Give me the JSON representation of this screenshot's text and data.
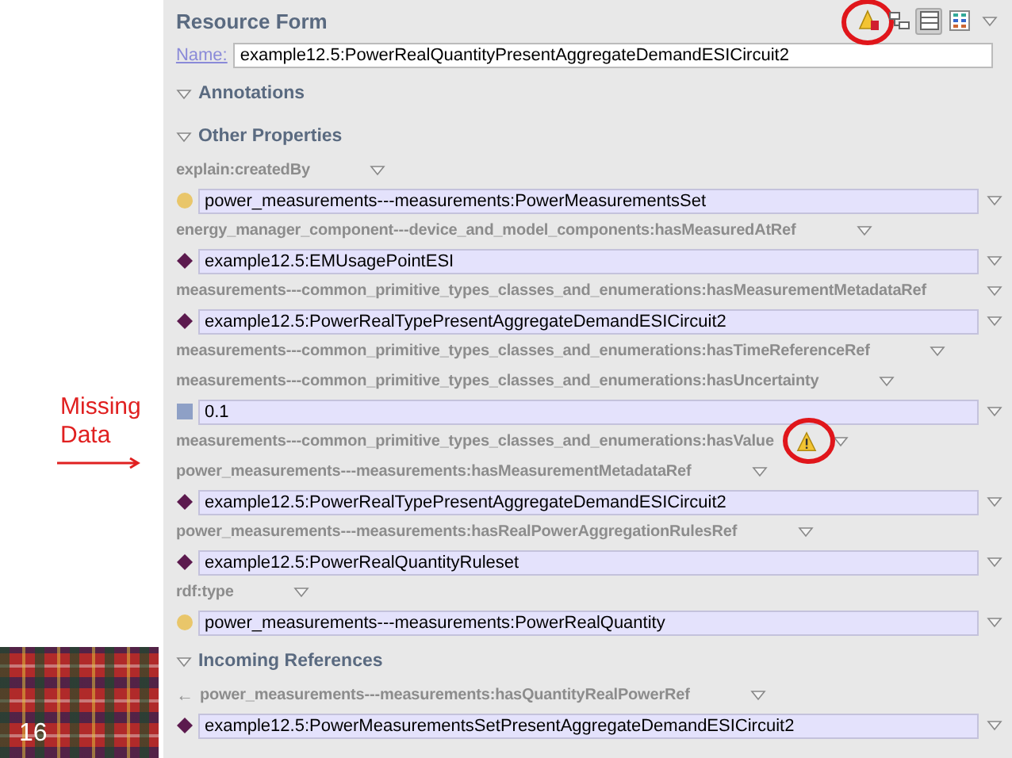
{
  "slide": {
    "callout": "Missing Data",
    "page_number": "16"
  },
  "form": {
    "title": "Resource Form",
    "toolbar": [
      {
        "kind": "warning",
        "pressed": false,
        "circled": true
      },
      {
        "kind": "hierarchy",
        "pressed": false,
        "circled": false
      },
      {
        "kind": "layout",
        "pressed": true,
        "circled": false
      },
      {
        "kind": "grid",
        "pressed": false,
        "circled": false
      },
      {
        "kind": "menu",
        "pressed": false,
        "circled": false
      }
    ],
    "name_label": "Name:",
    "name_value": "example12.5:PowerRealQuantityPresentAggregateDemandESICircuit2",
    "sections": [
      {
        "title": "Annotations"
      },
      {
        "title": "Other Properties",
        "properties": [
          {
            "label": "explain:createdBy",
            "warning": false,
            "value": {
              "kind": "circle",
              "text": "power_measurements---measurements:PowerMeasurementsSet"
            }
          },
          {
            "label": "energy_manager_component---device_and_model_components:hasMeasuredAtRef",
            "warning": false,
            "value": {
              "kind": "diamond",
              "text": "example12.5:EMUsagePointESI"
            }
          },
          {
            "label": "measurements---common_primitive_types_classes_and_enumerations:hasMeasurementMetadataRef",
            "warning": false,
            "value": {
              "kind": "diamond",
              "text": "example12.5:PowerRealTypePresentAggregateDemandESICircuit2"
            }
          },
          {
            "label": "measurements---common_primitive_types_classes_and_enumerations:hasTimeReferenceRef",
            "warning": false
          },
          {
            "label": "measurements---common_primitive_types_classes_and_enumerations:hasUncertainty",
            "warning": false,
            "value": {
              "kind": "square",
              "text": "0.1"
            }
          },
          {
            "label": "measurements---common_primitive_types_classes_and_enumerations:hasValue",
            "warning": true
          },
          {
            "label": "power_measurements---measurements:hasMeasurementMetadataRef",
            "warning": false,
            "value": {
              "kind": "diamond",
              "text": "example12.5:PowerRealTypePresentAggregateDemandESICircuit2"
            }
          },
          {
            "label": "power_measurements---measurements:hasRealPowerAggregationRulesRef",
            "warning": false,
            "value": {
              "kind": "diamond",
              "text": "example12.5:PowerRealQuantityRuleset"
            }
          },
          {
            "label": "rdf:type",
            "warning": false,
            "value": {
              "kind": "circle",
              "text": "power_measurements---measurements:PowerRealQuantity"
            }
          }
        ]
      },
      {
        "title": "Incoming References",
        "properties": [
          {
            "prefix": "←",
            "label": "power_measurements---measurements:hasQuantityRealPowerRef",
            "warning": false,
            "value": {
              "kind": "diamond",
              "text": "example12.5:PowerMeasurementsSetPresentAggregateDemandESICircuit2"
            }
          }
        ]
      }
    ]
  }
}
